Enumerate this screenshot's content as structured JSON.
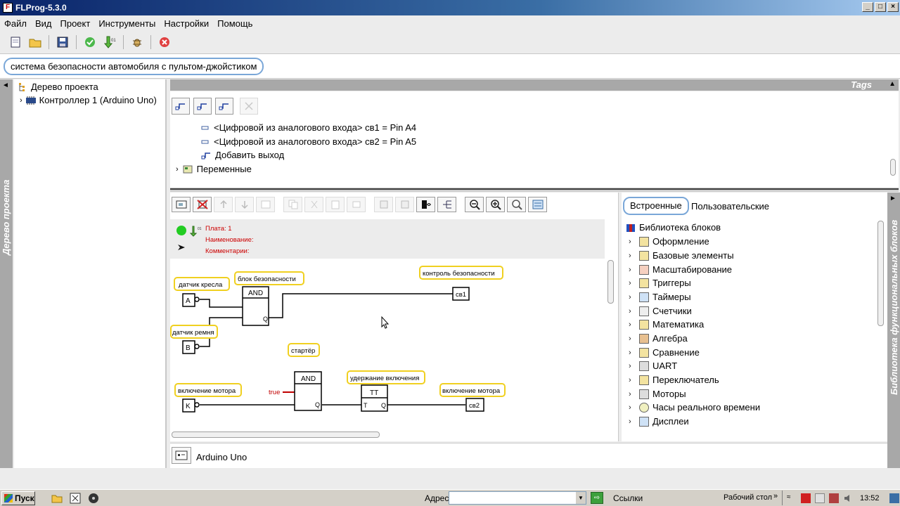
{
  "window": {
    "title": "FLProg-5.3.0",
    "controls": [
      "_",
      "□",
      "×"
    ]
  },
  "menu": [
    "Файл",
    "Вид",
    "Проект",
    "Инструменты",
    "Настройки",
    "Помощь"
  ],
  "toolbar": {
    "icons": [
      "new-file-icon",
      "open-folder-icon",
      "save-icon",
      "check-icon",
      "compile-upload-icon",
      "bug-icon",
      "stop-icon"
    ]
  },
  "project_name": "система безопасности автомобиля с пультом-джойстиком",
  "left_tab": {
    "label": "Дерево проекта",
    "arrow": "◄"
  },
  "tree": {
    "root": "Дерево проекта",
    "controller": "Контроллер 1 (Arduino Uno)"
  },
  "tags": {
    "header": "Tags",
    "header_arrow": "▲",
    "items": [
      "<Цифровой из аналогового входа> св1 = Pin A4",
      "<Цифровой из аналогового входа> св2 = Pin A5",
      "Добавить выход",
      "Переменные"
    ]
  },
  "board": {
    "line1": "Плата: 1",
    "line2": "Наименование:",
    "line3": "Комментарии:"
  },
  "diagram": {
    "labels": {
      "seat_sensor": "датчик кресла",
      "belt_sensor": "датчик ремня",
      "safety_block": "блок безопасности",
      "safety_control": "контроль безопасности",
      "starter": "стартёр",
      "motor_on_in": "включение мотора",
      "hold_on": "удержание включения",
      "motor_on_out": "включение мотора"
    },
    "inputs": {
      "a": "A",
      "b": "B",
      "k": "K"
    },
    "outputs": {
      "sv1": "св1",
      "sv2": "св2"
    },
    "gate1": {
      "name": "AND",
      "out": "Q"
    },
    "gate2": {
      "name": "AND",
      "out": "Q"
    },
    "trigger": {
      "name": "TT",
      "in": "T",
      "out": "Q"
    },
    "const_true": "true"
  },
  "library": {
    "tab_builtin": "Встроенные",
    "tab_user": "Пользовательские",
    "root": "Библиотека блоков",
    "items": [
      "Оформление",
      "Базовые элементы",
      "Масштабирование",
      "Триггеры",
      "Таймеры",
      "Счетчики",
      "Математика",
      "Алгебра",
      "Сравнение",
      "UART",
      "Переключатель",
      "Моторы",
      "Часы реального времени",
      "Дисплеи"
    ]
  },
  "right_tab": {
    "label": "Библиотека функциональных блоков",
    "arrow": "►"
  },
  "status": {
    "board": "Arduino Uno"
  },
  "taskbar": {
    "start": "Пуск",
    "address_label": "Адрес",
    "links": "Ссылки",
    "desktop": "Рабочий стол",
    "more": "»",
    "clock": "13:52"
  }
}
